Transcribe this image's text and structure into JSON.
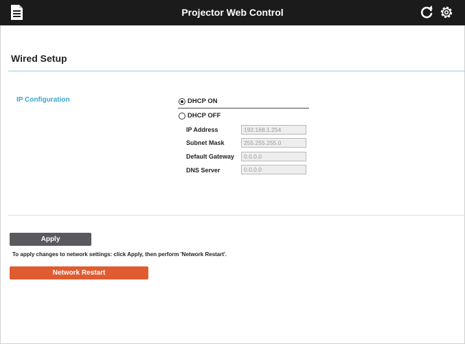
{
  "header": {
    "title": "Projector Web Control",
    "icons": {
      "menu": "menu-list-icon",
      "refresh": "refresh-icon",
      "settings": "gear-icon"
    },
    "background_color": "#1b1b1b"
  },
  "page": {
    "section_title": "Wired Setup"
  },
  "ip_configuration": {
    "label": "IP Configuration",
    "options": [
      {
        "label": "DHCP ON",
        "selected": true
      },
      {
        "label": "DHCP OFF",
        "selected": false
      }
    ],
    "fields": [
      {
        "label": "IP Address",
        "value": "192.168.1.254"
      },
      {
        "label": "Subnet Mask",
        "value": "255.255.255.0"
      },
      {
        "label": "Default Gateway",
        "value": "0.0.0.0"
      },
      {
        "label": "DNS Server",
        "value": "0.0.0.0"
      }
    ]
  },
  "actions": {
    "apply_label": "Apply",
    "hint": "To apply changes to network settings: click Apply, then perform 'Network Restart'.",
    "restart_label": "Network Restart",
    "apply_color": "#5a5a5e",
    "restart_color": "#e05b30"
  }
}
